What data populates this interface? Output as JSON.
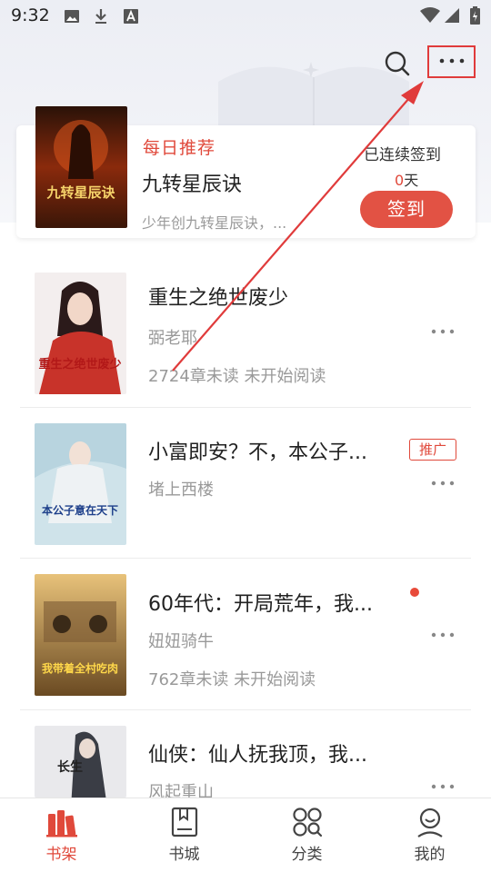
{
  "status_bar": {
    "time": "9:32",
    "icons": [
      "image-icon",
      "download-icon",
      "a-box-icon",
      "wifi-icon",
      "signal-icon",
      "battery-icon"
    ]
  },
  "header": {
    "actions": [
      "search-icon",
      "more-icon"
    ]
  },
  "daily": {
    "label": "每日推荐",
    "title": "九转星辰诀",
    "desc": "少年创九转星辰诀，...",
    "sign_label": "已连续签到",
    "sign_days": "0",
    "sign_days_unit": "天",
    "sign_button": "签到",
    "cover_title": "九转星辰诀"
  },
  "books": [
    {
      "title": "重生之绝世废少",
      "author": "弼老耶",
      "progress": "2724章未读 未开始阅读",
      "cover_text": "重生之绝世废少",
      "badge": "",
      "dot": false
    },
    {
      "title": "小富即安？不，本公子...",
      "author": "堵上西楼",
      "progress": "",
      "cover_text": "本公子意在天下",
      "badge": "推广",
      "dot": false
    },
    {
      "title": "60年代：开局荒年，我...",
      "author": "妞妞骑牛",
      "progress": "762章未读 未开始阅读",
      "cover_text": "我带着全村吃肉",
      "badge": "",
      "dot": true
    },
    {
      "title": "仙侠：仙人抚我顶，我...",
      "author": "风起重山",
      "progress": "",
      "cover_text": "长生",
      "badge": "",
      "dot": false
    }
  ],
  "nav": [
    {
      "label": "书架",
      "icon": "bookshelf-icon",
      "active": true
    },
    {
      "label": "书城",
      "icon": "bookstore-icon",
      "active": false
    },
    {
      "label": "分类",
      "icon": "category-icon",
      "active": false
    },
    {
      "label": "我的",
      "icon": "profile-icon",
      "active": false
    }
  ],
  "colors": {
    "accent": "#e0493b",
    "annotation": "#e03b3b",
    "header_bg": "#eceef4"
  }
}
